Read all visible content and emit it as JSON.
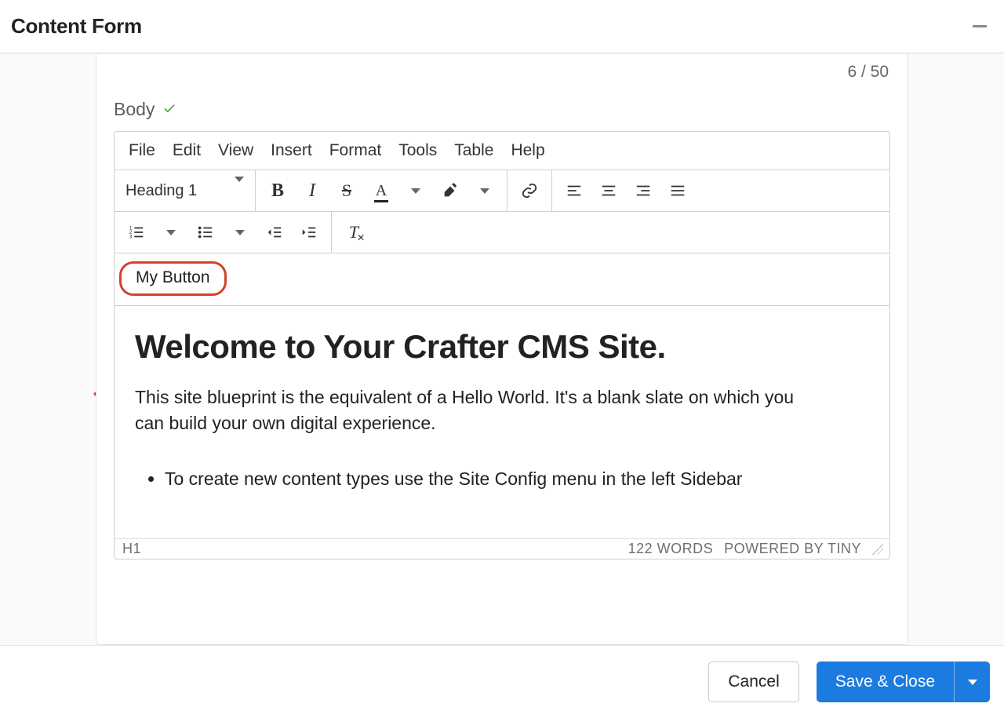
{
  "window": {
    "title": "Content Form"
  },
  "panel": {
    "counter": "6 / 50",
    "field_label": "Body"
  },
  "editor": {
    "menus": [
      "File",
      "Edit",
      "View",
      "Insert",
      "Format",
      "Tools",
      "Table",
      "Help"
    ],
    "format_selector": "Heading 1",
    "custom_button": "My Button",
    "content": {
      "heading": "Welcome to Your Crafter CMS Site.",
      "paragraph": "This site blueprint is the equivalent of a Hello World. It's a blank slate on which you can build your own digital experience.",
      "bullet1": "To create new content types use the Site Config menu in the left Sidebar"
    },
    "status": {
      "path": "H1",
      "words": "122 WORDS",
      "powered": "POWERED BY TINY"
    }
  },
  "footer": {
    "cancel": "Cancel",
    "save": "Save & Close"
  }
}
